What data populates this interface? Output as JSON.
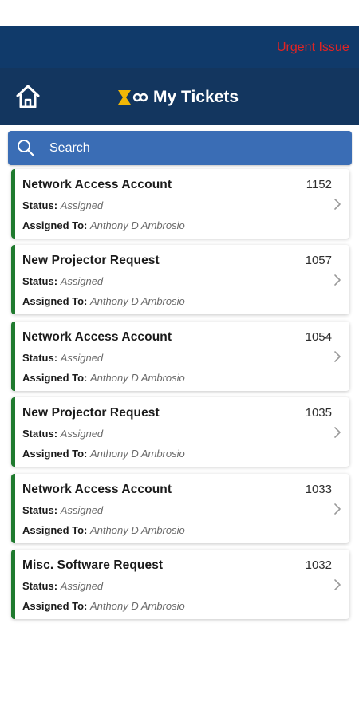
{
  "banner": {
    "text": "Urgent Issue"
  },
  "header": {
    "title": "My Tickets"
  },
  "search": {
    "placeholder": "Search"
  },
  "labels": {
    "status": "Status:",
    "assigned_to": "Assigned To:"
  },
  "tickets": [
    {
      "title": "Network Access Account",
      "id": "1152",
      "status": "Assigned",
      "assignee": "Anthony D Ambrosio"
    },
    {
      "title": "New Projector Request",
      "id": "1057",
      "status": "Assigned",
      "assignee": "Anthony D Ambrosio"
    },
    {
      "title": "Network Access Account",
      "id": "1054",
      "status": "Assigned",
      "assignee": "Anthony D Ambrosio"
    },
    {
      "title": "New Projector Request",
      "id": "1035",
      "status": "Assigned",
      "assignee": "Anthony D Ambrosio"
    },
    {
      "title": "Network Access Account",
      "id": "1033",
      "status": "Assigned",
      "assignee": "Anthony D Ambrosio"
    },
    {
      "title": "Misc. Software Request",
      "id": "1032",
      "status": "Assigned",
      "assignee": "Anthony D Ambrosio"
    }
  ],
  "icons": {
    "home": "home-icon",
    "logo": "app-logo-icon",
    "search": "search-icon",
    "chevron": "chevron-right-icon"
  },
  "colors": {
    "banner_bg": "#103a6a",
    "appbar_bg": "#13365f",
    "search_bg": "#3a6db5",
    "accent_green": "#1f7a2e",
    "urgent_red": "#e02424"
  }
}
